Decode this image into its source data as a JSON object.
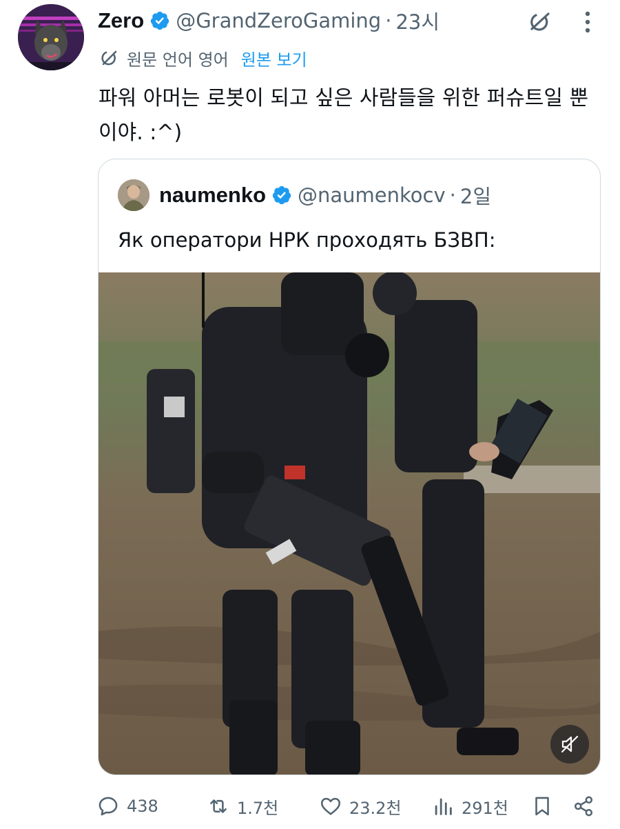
{
  "tweet": {
    "author": {
      "name": "Zero",
      "handle": "@GrandZeroGaming",
      "separator": "·",
      "time": "23시",
      "avatar_icon": "wolf-avatar"
    },
    "translation": {
      "label": "원문 언어 영어",
      "show_original": "원본 보기"
    },
    "text": "파워 아머는 로봇이 되고 싶은 사람들을 위한 퍼슈트일 뿐이야. :^)",
    "quoted": {
      "name": "naumenko",
      "handle": "@naumenkocv",
      "separator": "·",
      "time": "2일",
      "text": "Як оператори НРК проходять БЗВП:",
      "media_icon": "video-thumbnail",
      "muted": true
    },
    "actions": {
      "replies": "438",
      "reposts": "1.7천",
      "likes": "23.2천",
      "views": "291천"
    }
  },
  "colors": {
    "text_primary": "#0f1419",
    "text_secondary": "#536471",
    "link": "#1d9bf0",
    "verified": "#1d9bf0",
    "border": "#cfd9de"
  }
}
